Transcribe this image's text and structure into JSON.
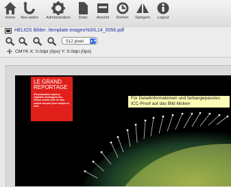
{
  "toolbar": {
    "home": "Home",
    "reload": "Neu laden",
    "admin": "Administration",
    "file": "Datei",
    "view": "Ansicht",
    "rotate": "Drehen",
    "mirror": "Spiegeln",
    "logout": "Logout"
  },
  "path": "HELIOS Bilder: /template-images%0/IL14_0056.pdf",
  "zoom": {
    "selected": "512 pixel"
  },
  "info": "CMYK  X: 0.0dpi (0px) Y: 0.0dpi (0px)",
  "image": {
    "red_box_title": "LE GRAND\nREPORTAGE",
    "red_box_body": "D'innombrables espèces végétales développent des trésors comme celle de cette colonie conçues pour conjurer la mort",
    "tooltip": "Für Detailinformationen und farbangepasstes ICC-Proof auf das Bild klicken"
  },
  "colors": {
    "link": "#1a2f9e",
    "accent": "#e0201b",
    "tooltip_bg": "#fffdb5",
    "select_arrow": "#3a6ee8"
  }
}
